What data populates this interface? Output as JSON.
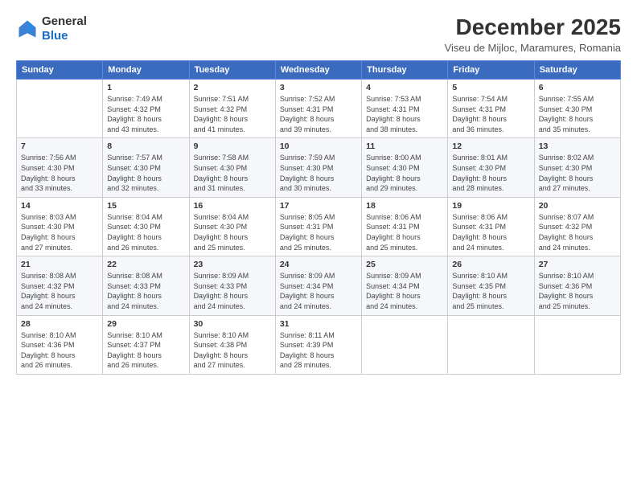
{
  "logo": {
    "line1": "General",
    "line2": "Blue"
  },
  "title": "December 2025",
  "subtitle": "Viseu de Mijloc, Maramures, Romania",
  "days_of_week": [
    "Sunday",
    "Monday",
    "Tuesday",
    "Wednesday",
    "Thursday",
    "Friday",
    "Saturday"
  ],
  "weeks": [
    [
      {
        "num": "",
        "info": ""
      },
      {
        "num": "1",
        "info": "Sunrise: 7:49 AM\nSunset: 4:32 PM\nDaylight: 8 hours\nand 43 minutes."
      },
      {
        "num": "2",
        "info": "Sunrise: 7:51 AM\nSunset: 4:32 PM\nDaylight: 8 hours\nand 41 minutes."
      },
      {
        "num": "3",
        "info": "Sunrise: 7:52 AM\nSunset: 4:31 PM\nDaylight: 8 hours\nand 39 minutes."
      },
      {
        "num": "4",
        "info": "Sunrise: 7:53 AM\nSunset: 4:31 PM\nDaylight: 8 hours\nand 38 minutes."
      },
      {
        "num": "5",
        "info": "Sunrise: 7:54 AM\nSunset: 4:31 PM\nDaylight: 8 hours\nand 36 minutes."
      },
      {
        "num": "6",
        "info": "Sunrise: 7:55 AM\nSunset: 4:30 PM\nDaylight: 8 hours\nand 35 minutes."
      }
    ],
    [
      {
        "num": "7",
        "info": "Sunrise: 7:56 AM\nSunset: 4:30 PM\nDaylight: 8 hours\nand 33 minutes."
      },
      {
        "num": "8",
        "info": "Sunrise: 7:57 AM\nSunset: 4:30 PM\nDaylight: 8 hours\nand 32 minutes."
      },
      {
        "num": "9",
        "info": "Sunrise: 7:58 AM\nSunset: 4:30 PM\nDaylight: 8 hours\nand 31 minutes."
      },
      {
        "num": "10",
        "info": "Sunrise: 7:59 AM\nSunset: 4:30 PM\nDaylight: 8 hours\nand 30 minutes."
      },
      {
        "num": "11",
        "info": "Sunrise: 8:00 AM\nSunset: 4:30 PM\nDaylight: 8 hours\nand 29 minutes."
      },
      {
        "num": "12",
        "info": "Sunrise: 8:01 AM\nSunset: 4:30 PM\nDaylight: 8 hours\nand 28 minutes."
      },
      {
        "num": "13",
        "info": "Sunrise: 8:02 AM\nSunset: 4:30 PM\nDaylight: 8 hours\nand 27 minutes."
      }
    ],
    [
      {
        "num": "14",
        "info": "Sunrise: 8:03 AM\nSunset: 4:30 PM\nDaylight: 8 hours\nand 27 minutes."
      },
      {
        "num": "15",
        "info": "Sunrise: 8:04 AM\nSunset: 4:30 PM\nDaylight: 8 hours\nand 26 minutes."
      },
      {
        "num": "16",
        "info": "Sunrise: 8:04 AM\nSunset: 4:30 PM\nDaylight: 8 hours\nand 25 minutes."
      },
      {
        "num": "17",
        "info": "Sunrise: 8:05 AM\nSunset: 4:31 PM\nDaylight: 8 hours\nand 25 minutes."
      },
      {
        "num": "18",
        "info": "Sunrise: 8:06 AM\nSunset: 4:31 PM\nDaylight: 8 hours\nand 25 minutes."
      },
      {
        "num": "19",
        "info": "Sunrise: 8:06 AM\nSunset: 4:31 PM\nDaylight: 8 hours\nand 24 minutes."
      },
      {
        "num": "20",
        "info": "Sunrise: 8:07 AM\nSunset: 4:32 PM\nDaylight: 8 hours\nand 24 minutes."
      }
    ],
    [
      {
        "num": "21",
        "info": "Sunrise: 8:08 AM\nSunset: 4:32 PM\nDaylight: 8 hours\nand 24 minutes."
      },
      {
        "num": "22",
        "info": "Sunrise: 8:08 AM\nSunset: 4:33 PM\nDaylight: 8 hours\nand 24 minutes."
      },
      {
        "num": "23",
        "info": "Sunrise: 8:09 AM\nSunset: 4:33 PM\nDaylight: 8 hours\nand 24 minutes."
      },
      {
        "num": "24",
        "info": "Sunrise: 8:09 AM\nSunset: 4:34 PM\nDaylight: 8 hours\nand 24 minutes."
      },
      {
        "num": "25",
        "info": "Sunrise: 8:09 AM\nSunset: 4:34 PM\nDaylight: 8 hours\nand 24 minutes."
      },
      {
        "num": "26",
        "info": "Sunrise: 8:10 AM\nSunset: 4:35 PM\nDaylight: 8 hours\nand 25 minutes."
      },
      {
        "num": "27",
        "info": "Sunrise: 8:10 AM\nSunset: 4:36 PM\nDaylight: 8 hours\nand 25 minutes."
      }
    ],
    [
      {
        "num": "28",
        "info": "Sunrise: 8:10 AM\nSunset: 4:36 PM\nDaylight: 8 hours\nand 26 minutes."
      },
      {
        "num": "29",
        "info": "Sunrise: 8:10 AM\nSunset: 4:37 PM\nDaylight: 8 hours\nand 26 minutes."
      },
      {
        "num": "30",
        "info": "Sunrise: 8:10 AM\nSunset: 4:38 PM\nDaylight: 8 hours\nand 27 minutes."
      },
      {
        "num": "31",
        "info": "Sunrise: 8:11 AM\nSunset: 4:39 PM\nDaylight: 8 hours\nand 28 minutes."
      },
      {
        "num": "",
        "info": ""
      },
      {
        "num": "",
        "info": ""
      },
      {
        "num": "",
        "info": ""
      }
    ]
  ]
}
